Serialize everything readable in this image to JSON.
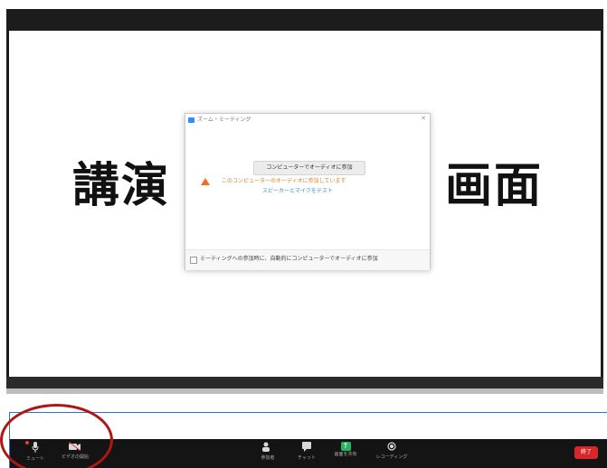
{
  "slide": {
    "left_text": "講演",
    "right_text": "画面"
  },
  "dialog": {
    "title": "ズーム・ミーティング",
    "close_glyph": "✕",
    "button_label": "コンピューターでオーディオに参加",
    "warning_line1": "このコンピューターのオーディオに参加しています",
    "warning_line2": "スピーカーとマイクをテスト",
    "footer_text": "ミーティングへの参加時に、自動的にコンピューターでオーディオに参加"
  },
  "toolbar": {
    "mute_label": "ミュート",
    "video_label": "ビデオの開始",
    "participants_count": "1",
    "participants_label": "参加者",
    "chat_label": "チャット",
    "share_label": "画面を共有",
    "record_label": "レコーディング",
    "end_label": "終了"
  },
  "icons": {
    "mute": "microphone-icon",
    "video": "video-camera-icon",
    "participants": "participants-icon",
    "chat": "chat-icon",
    "share": "share-screen-icon",
    "record": "record-icon",
    "warning": "warning-icon"
  },
  "colors": {
    "toolbar_bg": "#141414",
    "end_button": "#d9262b",
    "share_green": "#28b463",
    "warning_orange": "#f26d21",
    "link_blue": "#3a8ee6",
    "annotation_red": "#b01515"
  }
}
